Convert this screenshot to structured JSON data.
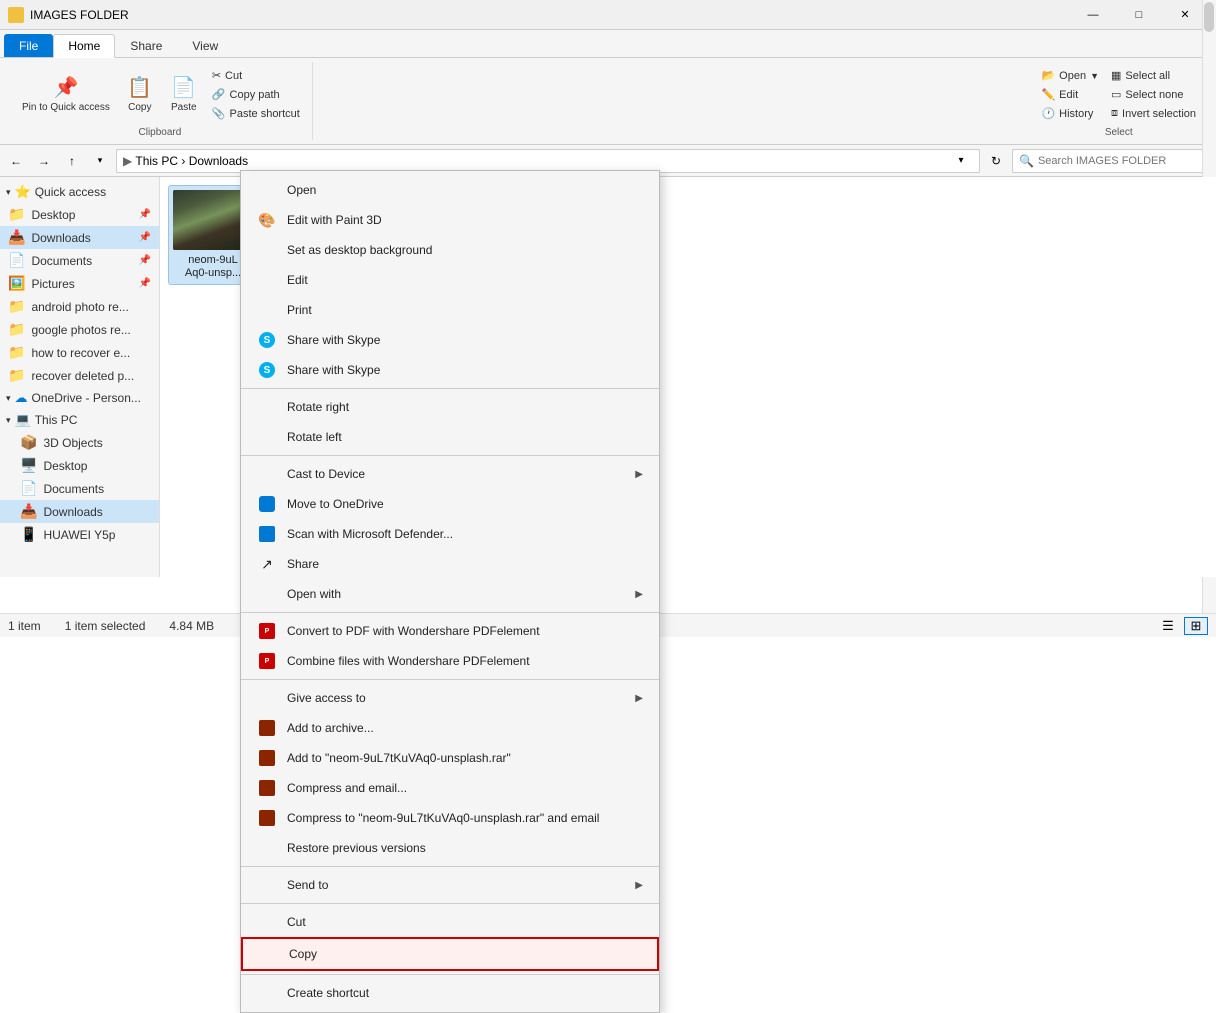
{
  "titlebar": {
    "title": "IMAGES FOLDER",
    "min_label": "—",
    "max_label": "□",
    "close_label": "✕"
  },
  "ribbon": {
    "tabs": [
      "File",
      "Home",
      "Share",
      "View"
    ],
    "active_tab": "Home",
    "groups": {
      "clipboard": {
        "label": "Clipboard",
        "pin_to_quick_access": "Pin to Quick\naccess",
        "copy_label": "Copy",
        "paste_label": "Paste",
        "cut_label": "Cut",
        "copy_path_label": "Copy path",
        "paste_shortcut_label": "Paste shortcut"
      },
      "select": {
        "label": "Select",
        "select_all": "Select all",
        "select_none": "Select none",
        "open_label": "Open",
        "edit_label": "Edit",
        "history_label": "History",
        "invert_selection": "Invert selection"
      }
    }
  },
  "toolbar": {
    "address_path": "This PC › Downloads",
    "search_placeholder": "Search IMAGES FOLDER"
  },
  "sidebar": {
    "quick_access_label": "Quick access",
    "items": [
      {
        "label": "Desktop",
        "icon": "📁",
        "pinned": true
      },
      {
        "label": "Downloads",
        "icon": "📥",
        "pinned": true,
        "active": true
      },
      {
        "label": "Documents",
        "icon": "📄",
        "pinned": true
      },
      {
        "label": "Pictures",
        "icon": "🖼️",
        "pinned": true
      },
      {
        "label": "android photo re...",
        "icon": "📁",
        "pinned": false
      },
      {
        "label": "google photos re...",
        "icon": "📁",
        "pinned": false
      },
      {
        "label": "how to recover e...",
        "icon": "📁",
        "pinned": false
      },
      {
        "label": "recover deleted p...",
        "icon": "📁",
        "pinned": false
      }
    ],
    "onedrive_label": "OneDrive - Person...",
    "this_pc_label": "This PC",
    "this_pc_items": [
      {
        "label": "3D Objects",
        "icon": "📦"
      },
      {
        "label": "Desktop",
        "icon": "🖥️"
      },
      {
        "label": "Documents",
        "icon": "📄"
      },
      {
        "label": "Downloads",
        "icon": "📥",
        "active": true
      },
      {
        "label": "HUAWEI Y5p",
        "icon": "📱"
      }
    ]
  },
  "content": {
    "file_name": "neom-9uL7tKuVAq0-unsplash",
    "file_name_short": "neom-9uL\nAq0-unsp..."
  },
  "context_menu": {
    "items": [
      {
        "id": "open",
        "label": "Open",
        "icon": "",
        "arrow": false
      },
      {
        "id": "edit-paint",
        "label": "Edit with Paint 3D",
        "icon": "🎨",
        "arrow": false
      },
      {
        "id": "set-desktop",
        "label": "Set as desktop background",
        "icon": "",
        "arrow": false
      },
      {
        "id": "edit",
        "label": "Edit",
        "icon": "",
        "arrow": false
      },
      {
        "id": "print",
        "label": "Print",
        "icon": "",
        "arrow": false
      },
      {
        "id": "share-skype1",
        "label": "Share with Skype",
        "icon": "skype",
        "arrow": false
      },
      {
        "id": "share-skype2",
        "label": "Share with Skype",
        "icon": "skype",
        "arrow": false
      },
      {
        "id": "rotate-right",
        "label": "Rotate right",
        "icon": "",
        "arrow": false
      },
      {
        "id": "rotate-left",
        "label": "Rotate left",
        "icon": "",
        "arrow": false
      },
      {
        "id": "cast",
        "label": "Cast to Device",
        "icon": "",
        "arrow": true
      },
      {
        "id": "onedrive",
        "label": "Move to OneDrive",
        "icon": "onedrive",
        "arrow": false
      },
      {
        "id": "defender",
        "label": "Scan with Microsoft Defender...",
        "icon": "defender",
        "arrow": false
      },
      {
        "id": "share",
        "label": "Share",
        "icon": "share",
        "arrow": false
      },
      {
        "id": "open-with",
        "label": "Open with",
        "icon": "",
        "arrow": true
      },
      {
        "id": "convert-pdf",
        "label": "Convert to PDF with Wondershare PDFelement",
        "icon": "pdf",
        "arrow": false
      },
      {
        "id": "combine-pdf",
        "label": "Combine files with Wondershare PDFelement",
        "icon": "pdf",
        "arrow": false
      },
      {
        "id": "give-access",
        "label": "Give access to",
        "icon": "",
        "arrow": true
      },
      {
        "id": "add-archive",
        "label": "Add to archive...",
        "icon": "winrar",
        "arrow": false
      },
      {
        "id": "add-rar",
        "label": "Add to \"neom-9uL7tKuVAq0-unsplash.rar\"",
        "icon": "winrar",
        "arrow": false
      },
      {
        "id": "compress",
        "label": "Compress and email...",
        "icon": "winrar",
        "arrow": false
      },
      {
        "id": "compress-rar",
        "label": "Compress to \"neom-9uL7tKuVAq0-unsplash.rar\" and email",
        "icon": "winrar",
        "arrow": false
      },
      {
        "id": "restore",
        "label": "Restore previous versions",
        "icon": "",
        "arrow": false
      },
      {
        "id": "send-to",
        "label": "Send to",
        "icon": "",
        "arrow": true
      },
      {
        "id": "cut",
        "label": "Cut",
        "icon": "",
        "arrow": false
      },
      {
        "id": "copy",
        "label": "Copy",
        "icon": "",
        "arrow": false,
        "highlighted": true
      },
      {
        "id": "create-shortcut",
        "label": "Create shortcut",
        "icon": "",
        "arrow": false
      }
    ]
  },
  "statusbar": {
    "item_count": "1 item",
    "selected_count": "1 item selected",
    "file_size": "4.84 MB"
  }
}
